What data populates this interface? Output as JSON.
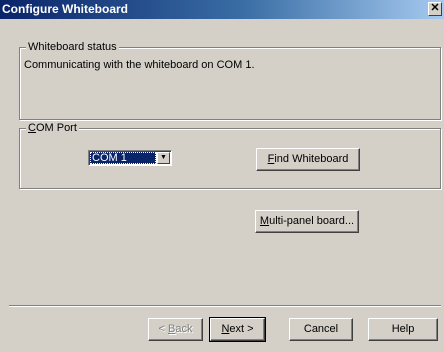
{
  "window": {
    "title": "Configure Whiteboard",
    "close_glyph": "✕"
  },
  "status_group": {
    "legend": "Whiteboard status",
    "message": "Communicating with the whiteboard on COM 1."
  },
  "com_group": {
    "legend_accel": "C",
    "legend_rest": "OM Port",
    "combo_value": "COM 1",
    "combo_arrow_icon": "chevron-down-icon",
    "find_accel": "F",
    "find_rest": "ind Whiteboard"
  },
  "multipanel": {
    "accel": "M",
    "rest": "ulti-panel board..."
  },
  "footer": {
    "back_accel": "B",
    "back_prefix": "< ",
    "back_rest": "ack",
    "next_accel": "N",
    "next_rest": "ext >",
    "cancel_label": "Cancel",
    "help_label": "Help"
  }
}
